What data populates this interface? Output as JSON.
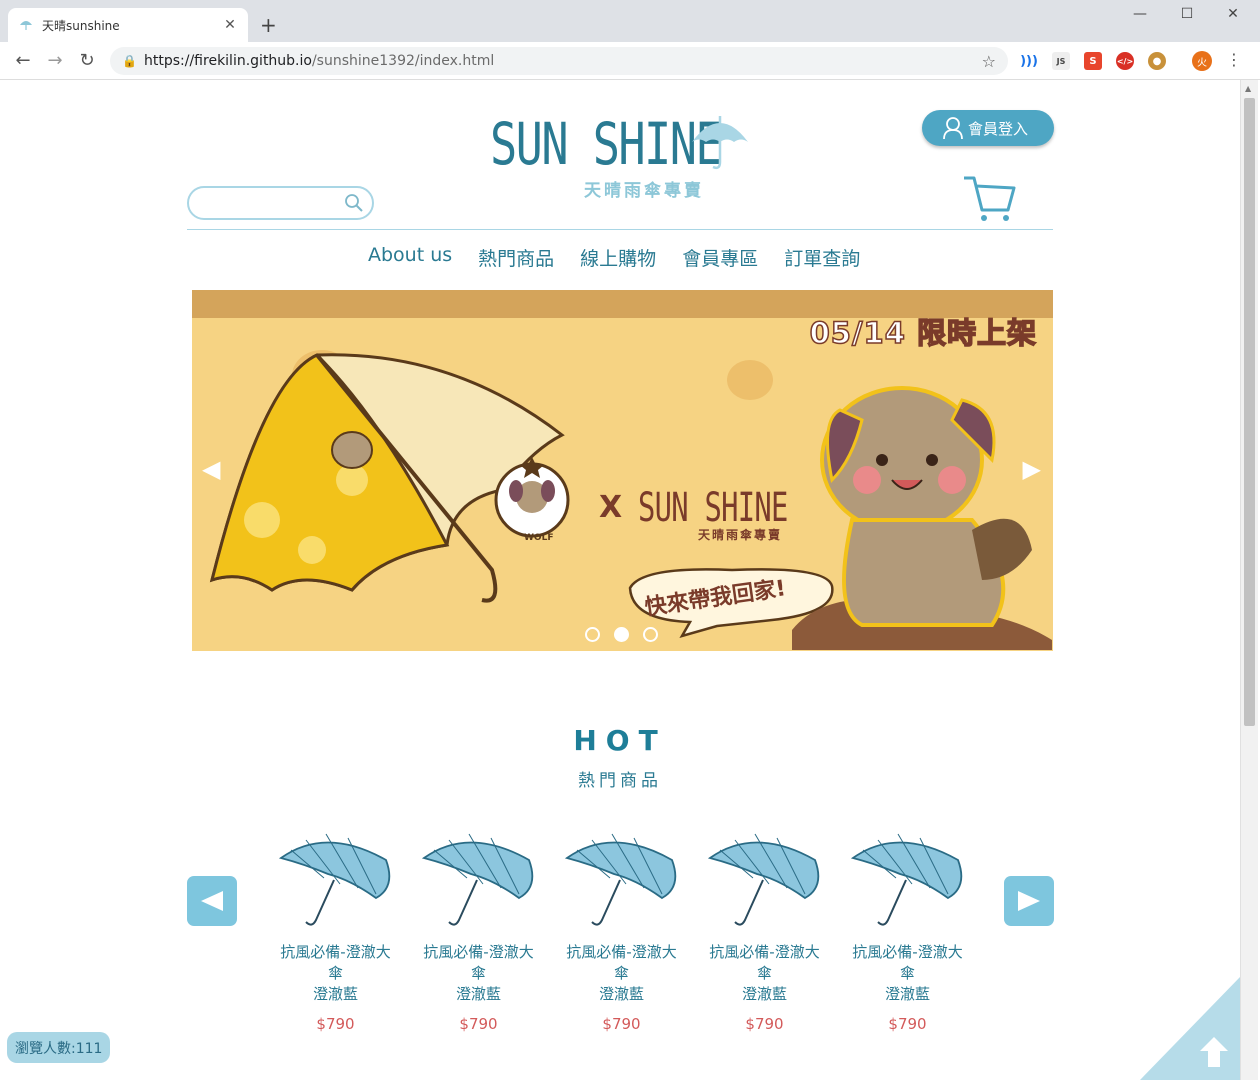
{
  "browser": {
    "tab_title": "天晴sunshine",
    "url_host": "https://firekilin.github.io",
    "url_path": "/sunshine1392/index.html",
    "profile_initial": "火"
  },
  "site": {
    "logo_text": "SUN SHINE",
    "logo_sub": "天晴雨傘專賣",
    "login_label": "會員登入",
    "search_placeholder": "",
    "nav": [
      "About us",
      "熱門商品",
      "線上購物",
      "會員專區",
      "訂單查詢"
    ]
  },
  "banner": {
    "date_text": "05/14  限時上架",
    "collab_x": "X",
    "collab_logo": "SUN SHINE",
    "collab_sub": "天晴雨傘專賣",
    "bubble_text": "快來帶我回家!",
    "badge_text": "WOLF",
    "slide_count": 3,
    "active_slide": 1
  },
  "hot": {
    "title": "HOT",
    "subtitle": "熱門商品",
    "products": [
      {
        "name": "抗風必備-澄澈大傘",
        "color": "澄澈藍",
        "price": "$790"
      },
      {
        "name": "抗風必備-澄澈大傘",
        "color": "澄澈藍",
        "price": "$790"
      },
      {
        "name": "抗風必備-澄澈大傘",
        "color": "澄澈藍",
        "price": "$790"
      },
      {
        "name": "抗風必備-澄澈大傘",
        "color": "澄澈藍",
        "price": "$790"
      },
      {
        "name": "抗風必備-澄澈大傘",
        "color": "澄澈藍",
        "price": "$790"
      }
    ]
  },
  "visitor_text": "瀏覽人數:111",
  "colors": {
    "brand": "#2a7a92",
    "accent": "#4ea6c4",
    "light": "#a9d6e5",
    "price": "#d35a5a"
  }
}
